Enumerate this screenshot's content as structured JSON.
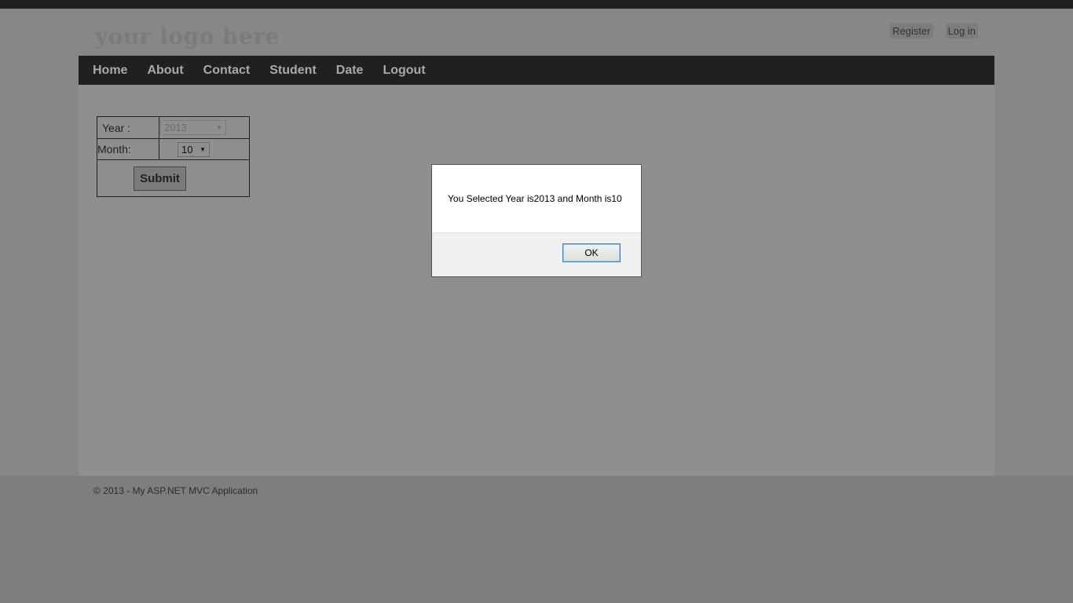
{
  "header": {
    "logo": "your logo here",
    "register_label": "Register",
    "login_label": "Log in"
  },
  "nav": {
    "items": [
      {
        "label": "Home"
      },
      {
        "label": "About"
      },
      {
        "label": "Contact"
      },
      {
        "label": "Student"
      },
      {
        "label": "Date"
      },
      {
        "label": "Logout"
      }
    ]
  },
  "form": {
    "year_label": "Year :",
    "year_value": "2013",
    "month_label": "Month:",
    "month_value": "10",
    "submit_label": "Submit"
  },
  "footer": {
    "text": "© 2013 - My ASP.NET MVC Application"
  },
  "dialog": {
    "message": "You Selected Year is2013 and Month is10",
    "ok_label": "OK"
  },
  "colors": {
    "navbar": "#1f2021",
    "overlay_dim": "#7d7e7f",
    "dialog_button_border": "#3c7fb1"
  }
}
